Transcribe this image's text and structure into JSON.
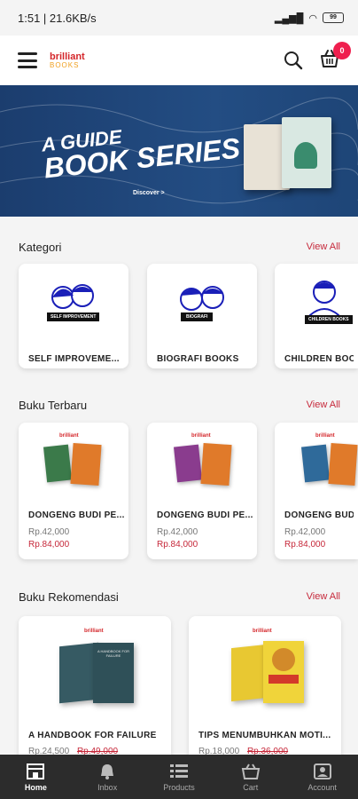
{
  "status": {
    "time_speed": "1:51 | 21.6KB/s",
    "battery": "99"
  },
  "header": {
    "logo_line1": "brilliant",
    "logo_line2": "BOOKS",
    "cart_count": "0"
  },
  "banner": {
    "title_line1": "A GUIDE",
    "title_line2": "BOOK SERIES",
    "cta": "Discover >"
  },
  "kategori": {
    "title": "Kategori",
    "view_all": "View All",
    "items": [
      {
        "tag": "SELF IMPROVEMENT",
        "label": "SELF IMPROVEME..."
      },
      {
        "tag": "BIOGRAFI",
        "label": "BIOGRAFI BOOKS"
      },
      {
        "tag": "CHILDREN BOOKS",
        "label": "CHILDREN BOOK"
      }
    ]
  },
  "terbaru": {
    "title": "Buku Terbaru",
    "view_all": "View All",
    "items": [
      {
        "label": "DONGENG BUDI PE...",
        "price_old": "Rp.42,000",
        "price_new": "Rp.84,000"
      },
      {
        "label": "DONGENG BUDI PE...",
        "price_old": "Rp.42,000",
        "price_new": "Rp.84,000"
      },
      {
        "label": "DONGENG BUDI P",
        "price_old": "Rp.42,000",
        "price_new": "Rp.84,000"
      }
    ]
  },
  "rekomendasi": {
    "title": "Buku Rekomendasi",
    "view_all": "View All",
    "items": [
      {
        "label": "A HANDBOOK FOR FAILURE",
        "price_old": "Rp.24,500",
        "price_new": "Rp.49,000",
        "cover_text": "A HANDBOOK FOR FAILURE"
      },
      {
        "label": "TIPS MENUMBUHKAN MOTI...",
        "price_old": "Rp.18,000",
        "price_new": "Rp.36,000"
      }
    ]
  },
  "nav": [
    {
      "label": "Home",
      "icon": "home-icon"
    },
    {
      "label": "Inbox",
      "icon": "bell-icon"
    },
    {
      "label": "Products",
      "icon": "list-icon"
    },
    {
      "label": "Cart",
      "icon": "cart-icon"
    },
    {
      "label": "Account",
      "icon": "account-icon"
    }
  ],
  "colors": {
    "accent": "#c6283a",
    "banner": "#1e4577",
    "nav_bg": "#2c2c2c",
    "badge": "#ef1f4e"
  }
}
